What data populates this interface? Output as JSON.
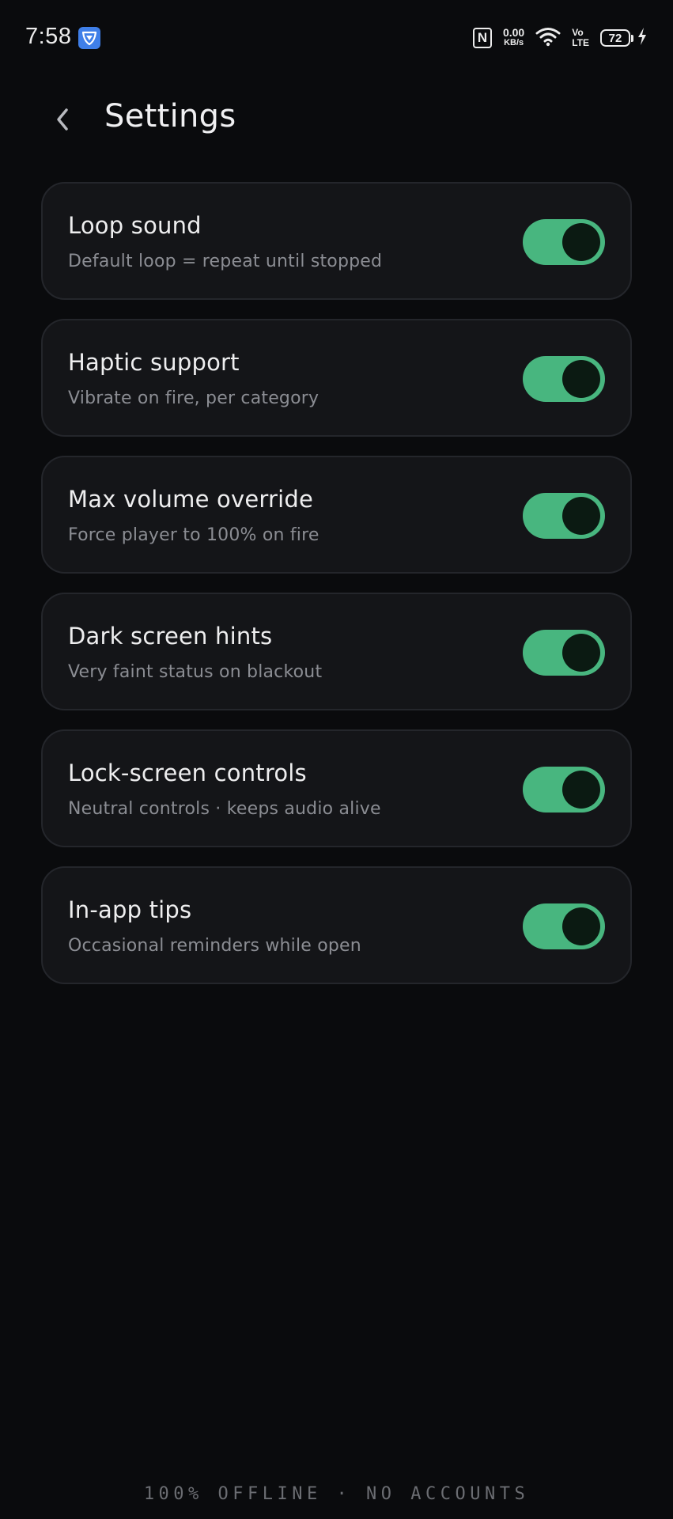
{
  "status_bar": {
    "time": "7:58",
    "network_speed_value": "0.00",
    "network_speed_unit": "KB/s",
    "volte_top": "Vo",
    "volte_bottom": "LTE",
    "battery_level": "72"
  },
  "header": {
    "title": "Settings"
  },
  "settings": [
    {
      "title": "Loop sound",
      "description": "Default loop = repeat until stopped",
      "enabled": true
    },
    {
      "title": "Haptic support",
      "description": "Vibrate on fire, per category",
      "enabled": true
    },
    {
      "title": "Max volume override",
      "description": "Force player to 100% on fire",
      "enabled": true
    },
    {
      "title": "Dark screen hints",
      "description": "Very faint status on blackout",
      "enabled": true
    },
    {
      "title": "Lock-screen controls",
      "description": "Neutral controls · keeps audio alive",
      "enabled": true
    },
    {
      "title": "In-app tips",
      "description": "Occasional reminders while open",
      "enabled": true
    }
  ],
  "footer": {
    "text": "100% OFFLINE · NO ACCOUNTS"
  },
  "colors": {
    "background": "#0a0b0d",
    "card": "#141518",
    "toggle_on": "#48b67f",
    "accent_shield": "#3f7fe8"
  }
}
